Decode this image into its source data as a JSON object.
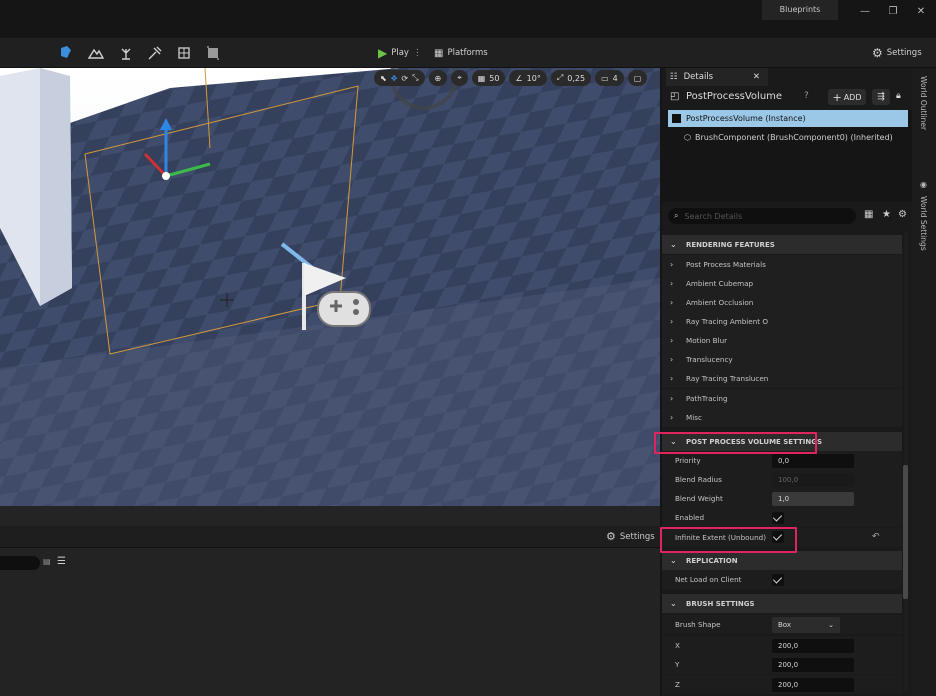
{
  "window": {
    "tab": "Blueprints",
    "controls": [
      "—",
      "❐",
      "✕"
    ]
  },
  "toolbar": {
    "play": "Play",
    "platforms": "Platforms",
    "settings": "Settings"
  },
  "viewport_tools": {
    "grid": "50",
    "angle": "10°",
    "scale": "0,25",
    "camera": "4"
  },
  "bottom": {
    "settings": "Settings"
  },
  "right_tabs": {
    "outliner": "World Outliner",
    "world_settings": "World Settings"
  },
  "details": {
    "tab": "Details",
    "title": "PostProcessVolume",
    "add": "ADD",
    "instance": "PostProcessVolume (Instance)",
    "brush": "BrushComponent (BrushComponent0) (Inherited)",
    "search_placeholder": "Search Details",
    "rendering_features": {
      "header": "RENDERING FEATURES",
      "items": [
        "Post Process Materials",
        "Ambient Cubemap",
        "Ambient Occlusion",
        "Ray Tracing Ambient O",
        "Motion Blur",
        "Translucency",
        "Ray Tracing Translucen",
        "PathTracing",
        "Misc"
      ]
    },
    "ppv_settings": {
      "header": "POST PROCESS VOLUME SETTINGS",
      "priority_label": "Priority",
      "priority": "0,0",
      "blend_radius_label": "Blend Radius",
      "blend_radius": "100,0",
      "blend_weight_label": "Blend Weight",
      "blend_weight": "1,0",
      "enabled_label": "Enabled",
      "infinite_label": "Infinite Extent (Unbound)"
    },
    "replication": {
      "header": "REPLICATION",
      "net_load": "Net Load on Client"
    },
    "brush_settings": {
      "header": "BRUSH SETTINGS",
      "shape_label": "Brush Shape",
      "shape": "Box",
      "x_label": "X",
      "x": "200,0",
      "y_label": "Y",
      "y": "200,0",
      "z_label": "Z",
      "z": "200,0"
    }
  },
  "colors": {
    "highlight": "#e0245e",
    "selected_row": "#9cc8e8",
    "play_green": "#6bc446"
  }
}
